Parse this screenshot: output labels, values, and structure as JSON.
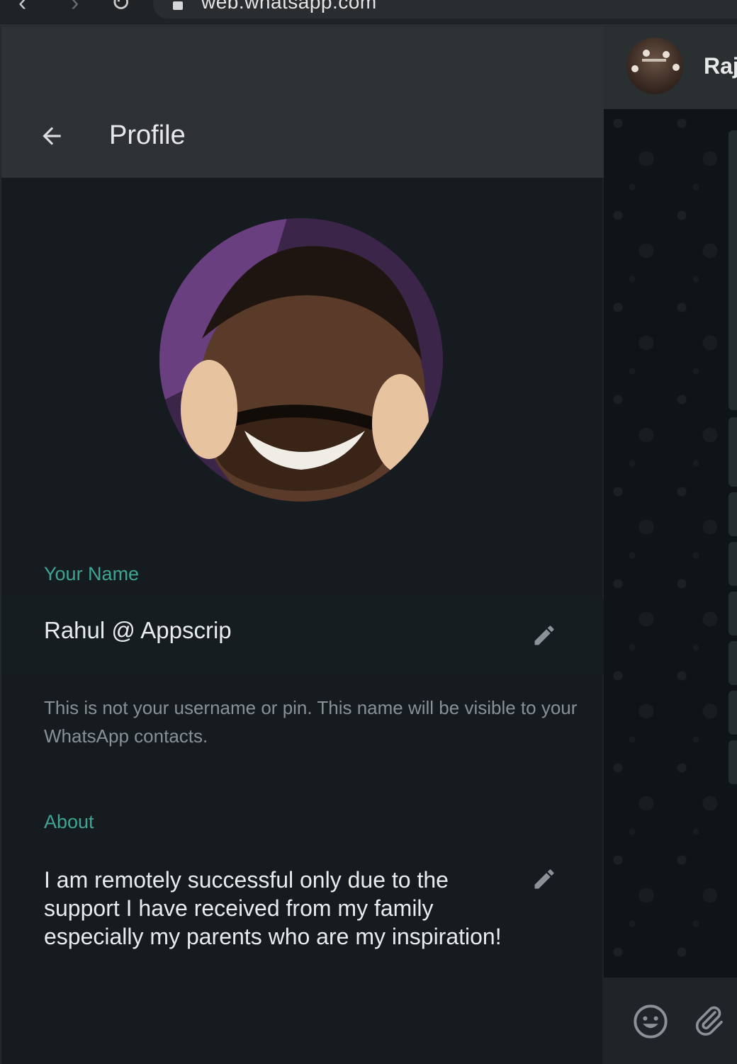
{
  "browser": {
    "url": "web.whatsapp.com"
  },
  "profile": {
    "header_title": "Profile",
    "name_label": "Your Name",
    "name_value": "Rahul @ Appscrip",
    "name_hint": "This is not your username or pin. This name will be visible to your WhatsApp contacts.",
    "about_label": "About",
    "about_value": "I am remotely successful only due to the support I have received from my family especially my parents who are my inspiration!"
  },
  "chat": {
    "contact_name": "Raj"
  },
  "colors": {
    "accent": "#3fa593",
    "panel_bg": "#151b1f",
    "header_bg": "#2e3236"
  },
  "icons": {
    "back": "arrow-left-icon",
    "edit": "pencil-icon",
    "emoji": "smiley-icon",
    "attach": "paperclip-icon"
  }
}
